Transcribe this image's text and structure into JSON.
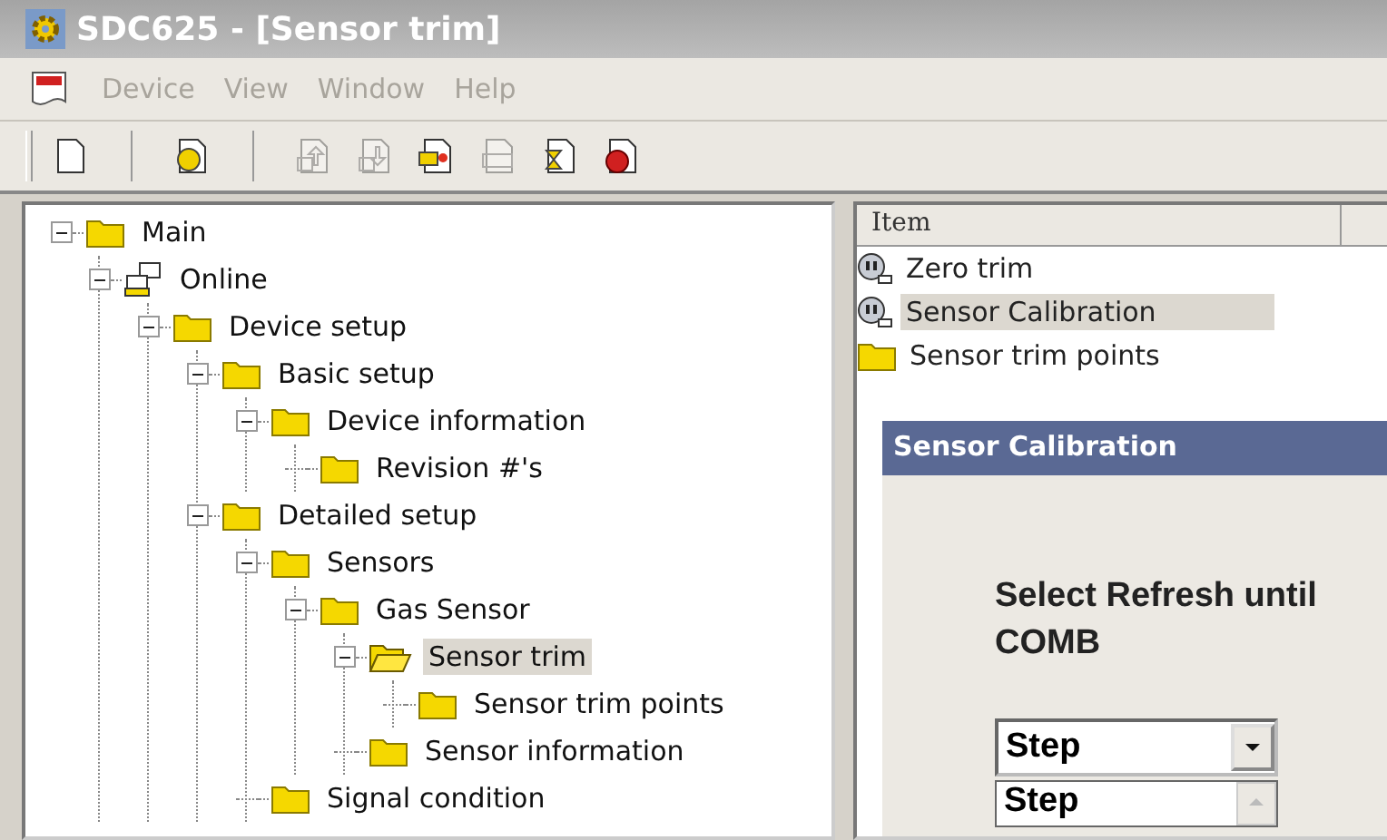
{
  "window": {
    "title": "SDC625 - [Sensor trim]"
  },
  "menu": [
    {
      "label": "Device",
      "disabled": true
    },
    {
      "label": "View",
      "disabled": true
    },
    {
      "label": "Window",
      "disabled": true
    },
    {
      "label": "Help",
      "disabled": true
    }
  ],
  "toolbar": [
    {
      "kind": "new",
      "disabled": false
    },
    {
      "kind": "help",
      "disabled": false
    },
    {
      "kind": "upload",
      "disabled": true
    },
    {
      "kind": "download",
      "disabled": true
    },
    {
      "kind": "method",
      "disabled": false
    },
    {
      "kind": "table",
      "disabled": true
    },
    {
      "kind": "wait",
      "disabled": false
    },
    {
      "kind": "stop",
      "disabled": false
    }
  ],
  "tree": [
    {
      "label": "Main",
      "kind": "folder",
      "expanded": true,
      "selected": false,
      "children": [
        {
          "label": "Online",
          "kind": "network",
          "expanded": true,
          "selected": false,
          "children": [
            {
              "label": "Device setup",
              "kind": "folder",
              "expanded": true,
              "selected": false,
              "children": [
                {
                  "label": "Basic setup",
                  "kind": "folder",
                  "expanded": true,
                  "selected": false,
                  "children": [
                    {
                      "label": "Device information",
                      "kind": "folder",
                      "expanded": true,
                      "selected": false,
                      "children": [
                        {
                          "label": "Revision #'s",
                          "kind": "folder",
                          "selected": false
                        }
                      ]
                    }
                  ]
                },
                {
                  "label": "Detailed setup",
                  "kind": "folder",
                  "expanded": true,
                  "selected": false,
                  "children": [
                    {
                      "label": "Sensors",
                      "kind": "folder",
                      "expanded": true,
                      "selected": false,
                      "children": [
                        {
                          "label": "Gas Sensor",
                          "kind": "folder",
                          "expanded": true,
                          "selected": false,
                          "children": [
                            {
                              "label": "Sensor trim",
                              "kind": "open-folder",
                              "expanded": true,
                              "selected": true,
                              "children": [
                                {
                                  "label": "Sensor trim points",
                                  "kind": "folder",
                                  "selected": false
                                }
                              ]
                            },
                            {
                              "label": "Sensor information",
                              "kind": "folder",
                              "selected": false
                            }
                          ]
                        }
                      ]
                    },
                    {
                      "label": "Signal condition",
                      "kind": "folder",
                      "selected": false
                    }
                  ]
                }
              ]
            }
          ]
        }
      ]
    }
  ],
  "list": {
    "columns": [
      "Item"
    ],
    "items": [
      {
        "label": "Zero trim",
        "kind": "method",
        "selected": false
      },
      {
        "label": "Sensor Calibration",
        "kind": "method",
        "selected": true
      },
      {
        "label": "Sensor trim points",
        "kind": "folder",
        "selected": false
      }
    ]
  },
  "dialog": {
    "title": "Sensor Calibration",
    "message_lines": [
      "Select Refresh until",
      "COMB"
    ],
    "combo": {
      "value": "Step"
    },
    "dropdown_first": "Step"
  }
}
